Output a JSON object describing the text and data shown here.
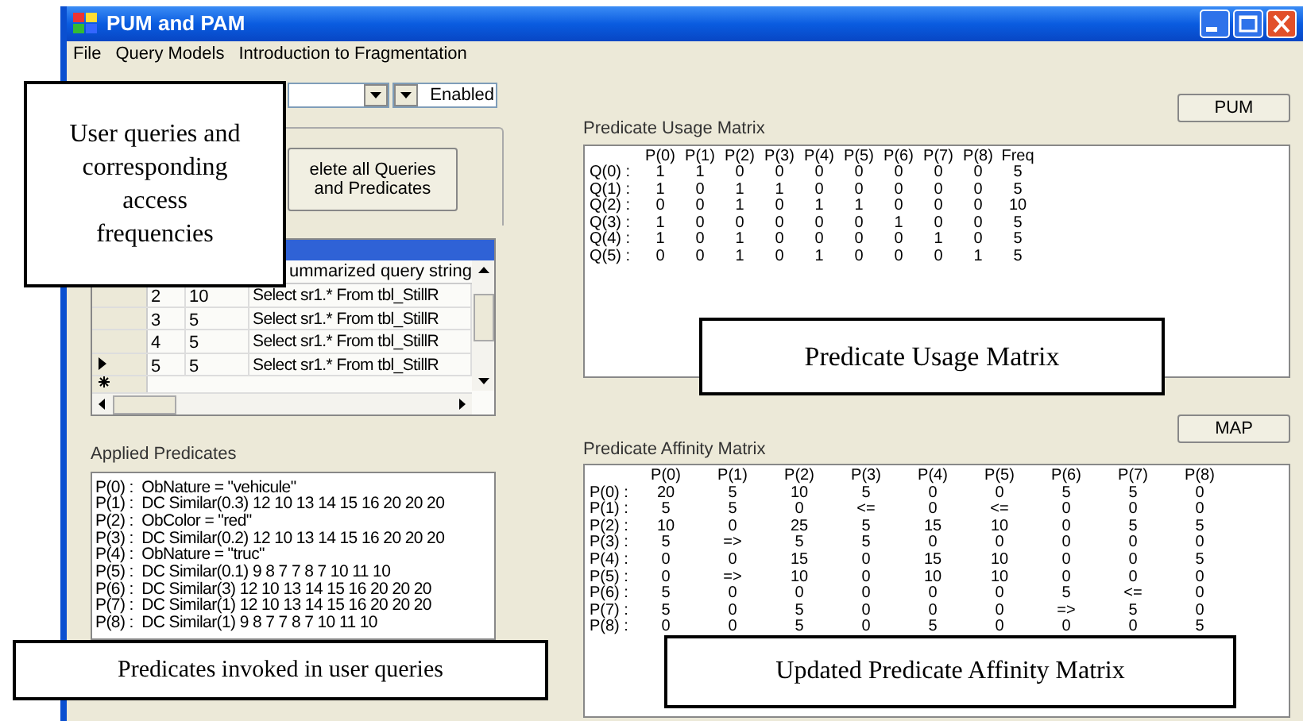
{
  "window": {
    "title": "PUM and PAM"
  },
  "menu": [
    "File",
    "Query Models",
    "Introduction to Fragmentation"
  ],
  "combo_2": {
    "value": "Enabled"
  },
  "delete_button": {
    "label": "elete all Queries and Predicates"
  },
  "query_grid": {
    "columns": [
      "",
      "",
      "ummarized query string"
    ],
    "rows": [
      {
        "selected": false,
        "cells": [
          "2",
          "10",
          "Select sr1.* From tbl_StillR"
        ]
      },
      {
        "selected": false,
        "cells": [
          "3",
          "5",
          "Select sr1.* From tbl_StillR"
        ]
      },
      {
        "selected": false,
        "cells": [
          "4",
          "5",
          "Select sr1.* From tbl_StillR"
        ]
      },
      {
        "selected": true,
        "cells": [
          "5",
          "5",
          "Select sr1.* From tbl_StillR"
        ]
      }
    ]
  },
  "applied_predicates": {
    "label": "Applied Predicates",
    "items": [
      "P(0) :  ObNature = \"vehicule\"",
      "P(1) :  DC Similar(0.3) 12 10 13 14 15 16 20 20 20",
      "P(2) :  ObColor = \"red\"",
      "P(3) :  DC Similar(0.2) 12 10 13 14 15 16 20 20 20",
      "P(4) :  ObNature = \"truc\"",
      "P(5) :  DC Similar(0.1) 9 8 7 7 8 7 10 11 10",
      "P(6) :  DC Similar(3) 12 10 13 14 15 16 20 20 20",
      "P(7) :  DC Similar(1) 12 10 13 14 15 16 20 20 20",
      "P(8) :  DC Similar(1) 9 8 7 7 8 7 10 11 10"
    ]
  },
  "pum_button": {
    "label": "PUM"
  },
  "usage_matrix": {
    "label": "Predicate Usage Matrix",
    "columns": [
      "P(0)",
      "P(1)",
      "P(2)",
      "P(3)",
      "P(4)",
      "P(5)",
      "P(6)",
      "P(7)",
      "P(8)",
      "Freq"
    ],
    "rows": [
      {
        "label": "Q(0) :",
        "values": [
          "1",
          "1",
          "0",
          "0",
          "0",
          "0",
          "0",
          "0",
          "0",
          "5"
        ]
      },
      {
        "label": "Q(1) :",
        "values": [
          "1",
          "0",
          "1",
          "1",
          "0",
          "0",
          "0",
          "0",
          "0",
          "5"
        ]
      },
      {
        "label": "Q(2) :",
        "values": [
          "0",
          "0",
          "1",
          "0",
          "1",
          "1",
          "0",
          "0",
          "0",
          "10"
        ]
      },
      {
        "label": "Q(3) :",
        "values": [
          "1",
          "0",
          "0",
          "0",
          "0",
          "0",
          "1",
          "0",
          "0",
          "5"
        ]
      },
      {
        "label": "Q(4) :",
        "values": [
          "1",
          "0",
          "1",
          "0",
          "0",
          "0",
          "0",
          "1",
          "0",
          "5"
        ]
      },
      {
        "label": "Q(5) :",
        "values": [
          "0",
          "0",
          "1",
          "0",
          "1",
          "0",
          "0",
          "0",
          "1",
          "5"
        ]
      }
    ]
  },
  "map_button": {
    "label": "MAP"
  },
  "affinity_matrix": {
    "label": "Predicate Affinity Matrix",
    "columns": [
      "P(0)",
      "P(1)",
      "P(2)",
      "P(3)",
      "P(4)",
      "P(5)",
      "P(6)",
      "P(7)",
      "P(8)"
    ],
    "rows": [
      {
        "label": "P(0) :",
        "values": [
          "20",
          "5",
          "10",
          "5",
          "0",
          "0",
          "5",
          "5",
          "0"
        ]
      },
      {
        "label": "P(1) :",
        "values": [
          "5",
          "5",
          "0",
          "<=",
          "0",
          "<=",
          "0",
          "0",
          "0"
        ]
      },
      {
        "label": "P(2) :",
        "values": [
          "10",
          "0",
          "25",
          "5",
          "15",
          "10",
          "0",
          "5",
          "5"
        ]
      },
      {
        "label": "P(3) :",
        "values": [
          "5",
          "=>",
          "5",
          "5",
          "0",
          "0",
          "0",
          "0",
          "0"
        ]
      },
      {
        "label": "P(4) :",
        "values": [
          "0",
          "0",
          "15",
          "0",
          "15",
          "10",
          "0",
          "0",
          "5"
        ]
      },
      {
        "label": "P(5) :",
        "values": [
          "0",
          "=>",
          "10",
          "0",
          "10",
          "10",
          "0",
          "0",
          "0"
        ]
      },
      {
        "label": "P(6) :",
        "values": [
          "5",
          "0",
          "0",
          "0",
          "0",
          "0",
          "5",
          "<=",
          "0"
        ]
      },
      {
        "label": "P(7) :",
        "values": [
          "5",
          "0",
          "5",
          "0",
          "0",
          "0",
          "=>",
          "5",
          "0"
        ]
      },
      {
        "label": "P(8) :",
        "values": [
          "0",
          "0",
          "5",
          "0",
          "5",
          "0",
          "0",
          "0",
          "5"
        ]
      }
    ]
  },
  "annotations": [
    "User queries and corresponding access frequencies",
    "Predicates invoked in user queries",
    "Predicate Usage Matrix",
    "Updated Predicate Affinity Matrix"
  ]
}
